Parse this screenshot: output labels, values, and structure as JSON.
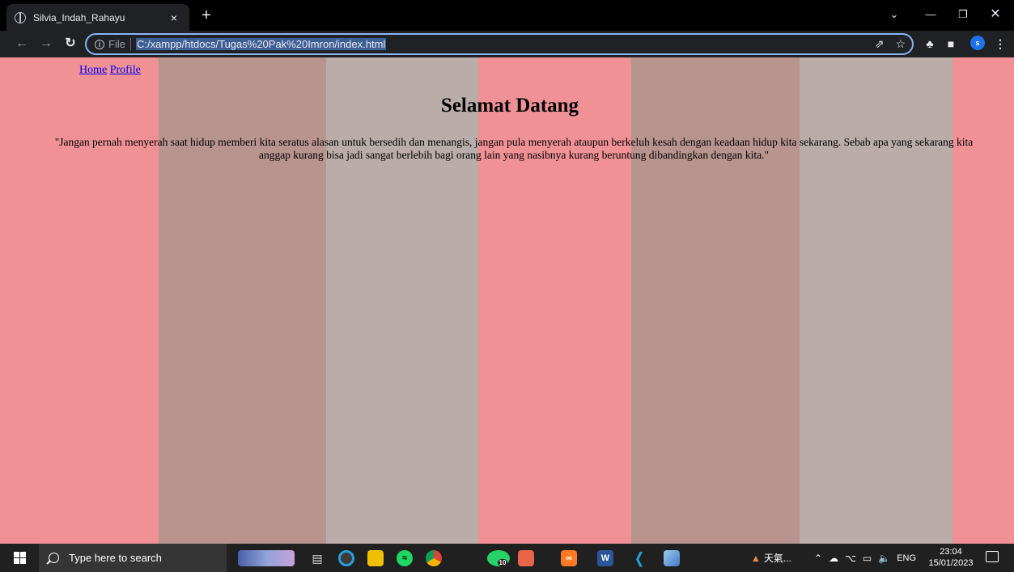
{
  "browser": {
    "tab_title": "Silvia_Indah_Rahayu",
    "tab_close": "×",
    "new_tab": "+",
    "address_scheme": "File",
    "address_url": "C:/xampp/htdocs/Tugas%20Pak%20Imron/index.html",
    "profile_initial": "s",
    "accent_color": "#8ab4f8"
  },
  "page": {
    "nav": {
      "home": "Home",
      "profile": "Profile"
    },
    "heading": "Selamat Datang",
    "quote": "\"Jangan pernah menyerah saat hidup memberi kita seratus alasan untuk bersedih dan menangis, jangan pula menyerah ataupun berkeluh kesah dengan keadaan hidup kita sekarang. Sebab apa yang sekarang kita anggap kurang bisa jadi sangat berlebih bagi orang lain yang nasibnya kurang beruntung dibandingkan dengan kita.\"",
    "colors": {
      "pink": "#f09196",
      "mauve": "#b8948f",
      "greige": "#b9aca9"
    }
  },
  "taskbar": {
    "search_placeholder": "Type here to search",
    "weather_text": "天氣...",
    "language": "ENG",
    "time": "23:04",
    "date": "15/01/2023",
    "whatsapp_badge": "10",
    "word_label": "W"
  }
}
